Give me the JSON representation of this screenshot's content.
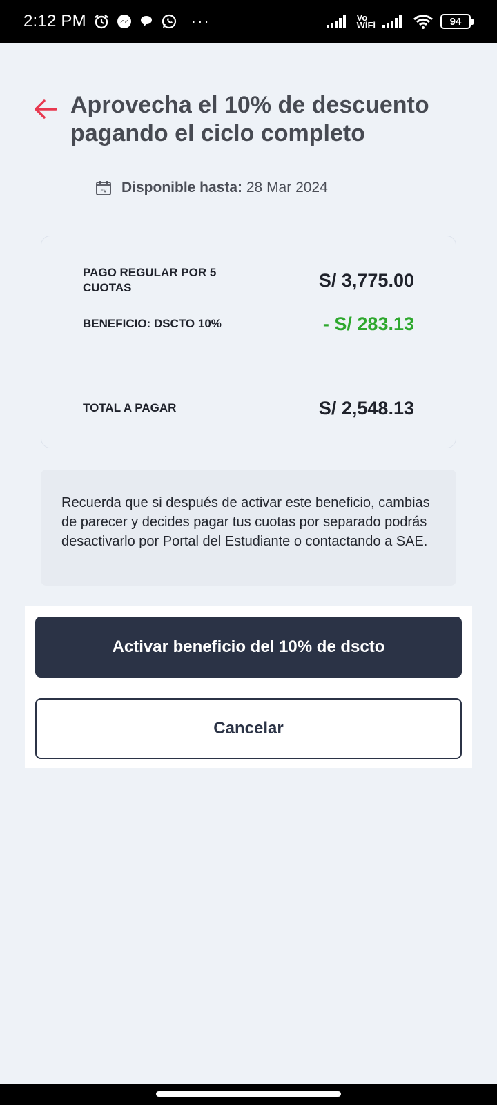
{
  "status_bar": {
    "time": "2:12 PM",
    "dots": "···",
    "vo": "Vo",
    "wifi": "WiFi",
    "battery": "94"
  },
  "header": {
    "title": "Aprovecha el 10% de descuento pagando el ciclo completo",
    "available_label": "Disponible hasta:",
    "available_date": "28 Mar 2024",
    "calendar_text": "FV"
  },
  "summary": {
    "regular_label": "PAGO REGULAR POR 5 CUOTAS",
    "regular_value": "S/ 3,775.00",
    "benefit_label": "BENEFICIO: DSCTO 10%",
    "benefit_value": "- S/ 283.13",
    "total_label": "TOTAL A PAGAR",
    "total_value": "S/ 2,548.13"
  },
  "note": "Recuerda que si después de activar este beneficio, cambias de parecer y decides pagar tus cuotas por separado podrás desactivarlo por Portal del Estudiante o contactando a SAE.",
  "actions": {
    "activate_label": "Activar beneficio del 10% de dscto",
    "cancel_label": "Cancelar"
  },
  "colors": {
    "accent_back": "#e8384f",
    "primary_button": "#2b3346",
    "discount_green": "#2ea82e",
    "background": "#eef2f7"
  },
  "icons": {
    "back": "arrow-left-icon",
    "calendar": "calendar-icon"
  }
}
